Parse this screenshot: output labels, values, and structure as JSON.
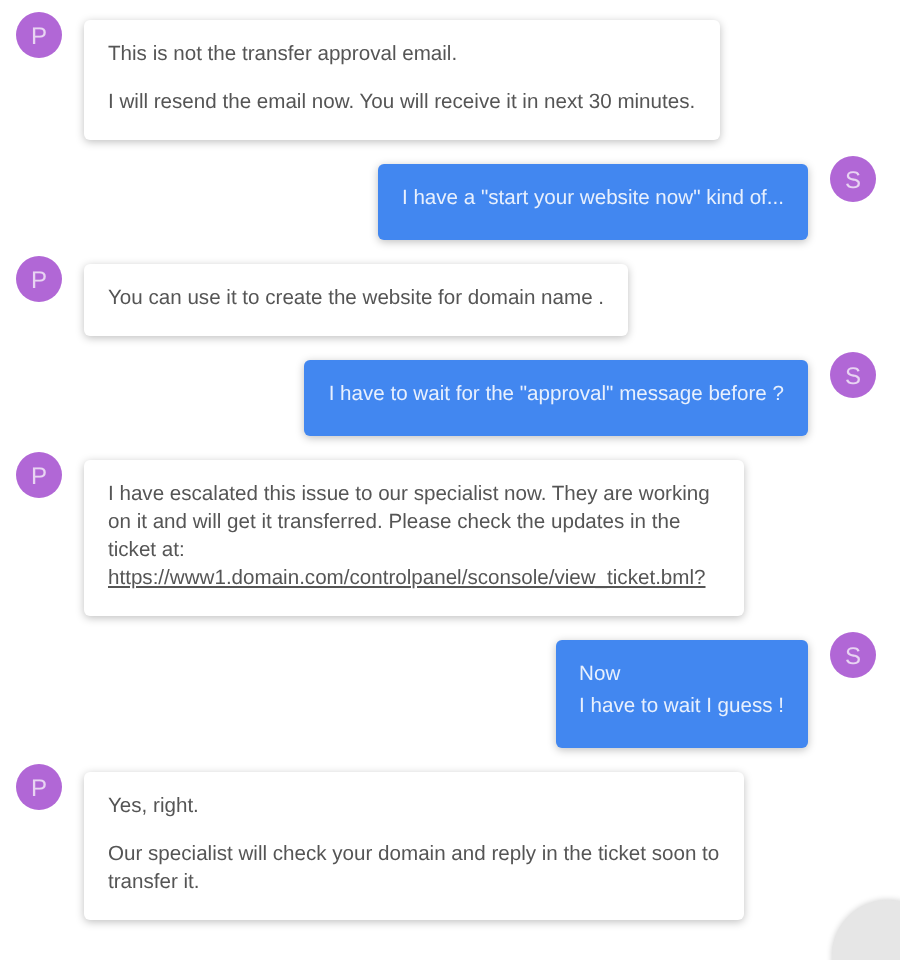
{
  "messages": [
    {
      "kind": "received",
      "avatar": "P",
      "paragraphs": [
        {
          "text": "This is not the transfer approval email."
        },
        {
          "text": "I will resend the email now. You will receive it in next 30 minutes."
        }
      ]
    },
    {
      "kind": "sent",
      "avatar": "S",
      "paragraphs": [
        {
          "text": "I have a \"start your website now\" kind of..."
        }
      ]
    },
    {
      "kind": "received",
      "avatar": "P",
      "paragraphs": [
        {
          "text": "You can use it to create the website for domain name ."
        }
      ]
    },
    {
      "kind": "sent",
      "avatar": "S",
      "paragraphs": [
        {
          "text": "I have to wait for the \"approval\" message before ?"
        }
      ]
    },
    {
      "kind": "received",
      "avatar": "P",
      "paragraphs": [
        {
          "text": " I have escalated this issue to our specialist now. They are working on it and will get it transferred. Please check the updates in the ticket at: ",
          "link": "https://www1.domain.com/controlpanel/sconsole/view_ticket.bml?"
        }
      ]
    },
    {
      "kind": "sent",
      "avatar": "S",
      "paragraphs": [
        {
          "text": "Now"
        },
        {
          "text": "I have to wait I guess !"
        }
      ]
    },
    {
      "kind": "received",
      "avatar": "P",
      "paragraphs": [
        {
          "text": "Yes, right."
        },
        {
          "text": "Our specialist will check your domain and reply in the ticket soon to transfer it."
        }
      ]
    }
  ]
}
